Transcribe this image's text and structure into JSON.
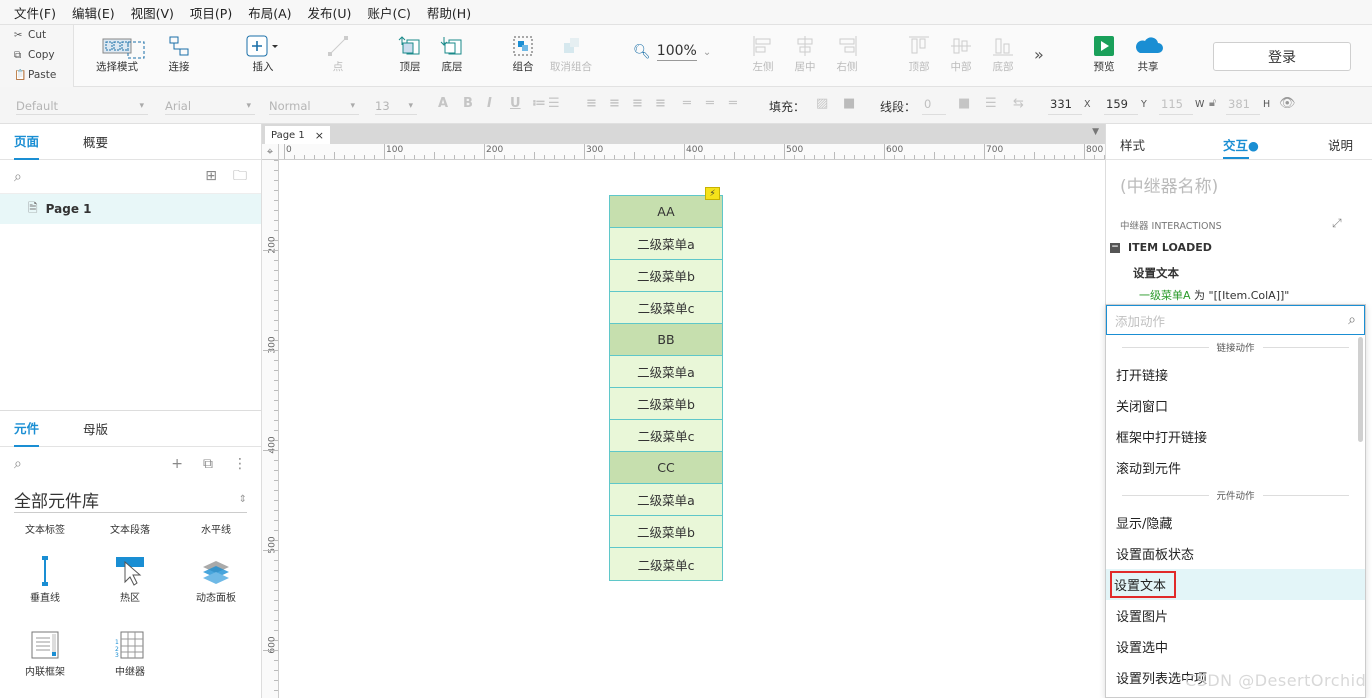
{
  "menu": [
    "文件(F)",
    "编辑(E)",
    "视图(V)",
    "项目(P)",
    "布局(A)",
    "发布(U)",
    "账户(C)",
    "帮助(H)"
  ],
  "clipboard": {
    "cut": "Cut",
    "copy": "Copy",
    "paste": "Paste"
  },
  "toolbar": {
    "select_mode": "选择模式",
    "connect": "连接",
    "insert": "插入",
    "point": "点",
    "top_layer": "顶层",
    "bottom_layer": "底层",
    "group": "组合",
    "ungroup": "取消组合",
    "zoom": "100%",
    "left": "左侧",
    "center": "居中",
    "right": "右侧",
    "top": "顶部",
    "middle": "中部",
    "bottom": "底部",
    "preview": "预览",
    "share": "共享",
    "login": "登录"
  },
  "format": {
    "style": "Default",
    "font": "Arial",
    "weight": "Normal",
    "size": "13",
    "fill_label": "填充：",
    "line_label": "线段：",
    "line_value": "0",
    "x": "331",
    "x_unit": "X",
    "y": "159",
    "y_unit": "Y",
    "w": "115",
    "w_unit": "W",
    "h": "381",
    "h_unit": "H"
  },
  "left": {
    "tab_pages": "页面",
    "tab_outline": "概要",
    "page": "Page 1",
    "tab_widgets": "元件",
    "tab_masters": "母版",
    "library": "全部元件库",
    "widgets": [
      "文本标签",
      "文本段落",
      "水平线",
      "垂直线",
      "热区",
      "动态面板",
      "内联框架",
      "中继器"
    ]
  },
  "canvas": {
    "tab": "Page 1",
    "ruler_h": [
      "0",
      "100",
      "200",
      "300",
      "400",
      "500",
      "600",
      "700",
      "800"
    ],
    "ruler_v": [
      "200",
      "300",
      "400",
      "500",
      "600"
    ],
    "repeater": [
      {
        "t": "AA",
        "l": 1
      },
      {
        "t": "二级菜单a",
        "l": 2
      },
      {
        "t": "二级菜单b",
        "l": 2
      },
      {
        "t": "二级菜单c",
        "l": 2
      },
      {
        "t": "BB",
        "l": 1
      },
      {
        "t": "二级菜单a",
        "l": 2
      },
      {
        "t": "二级菜单b",
        "l": 2
      },
      {
        "t": "二级菜单c",
        "l": 2
      },
      {
        "t": "CC",
        "l": 1
      },
      {
        "t": "二级菜单a",
        "l": 2
      },
      {
        "t": "二级菜单b",
        "l": 2
      },
      {
        "t": "二级菜单c",
        "l": 2
      }
    ]
  },
  "right": {
    "tab_style": "样式",
    "tab_interact": "交互",
    "tab_notes": "说明",
    "name_placeholder": "(中继器名称)",
    "section": "中继器 INTERACTIONS",
    "event": "ITEM LOADED",
    "action": "设置文本",
    "detail_target": "一级菜单A",
    "detail_rest": " 为 \"[[Item.ColA]]\""
  },
  "dropdown": {
    "placeholder": "添加动作",
    "sec1": "链接动作",
    "items1": [
      "打开链接",
      "关闭窗口",
      "框架中打开链接",
      "滚动到元件"
    ],
    "sec2": "元件动作",
    "items2": [
      "显示/隐藏",
      "设置面板状态",
      "设置文本",
      "设置图片",
      "设置选中",
      "设置列表选中项"
    ],
    "highlight": "设置文本"
  },
  "watermark": "CSDN @DesertOrchid"
}
